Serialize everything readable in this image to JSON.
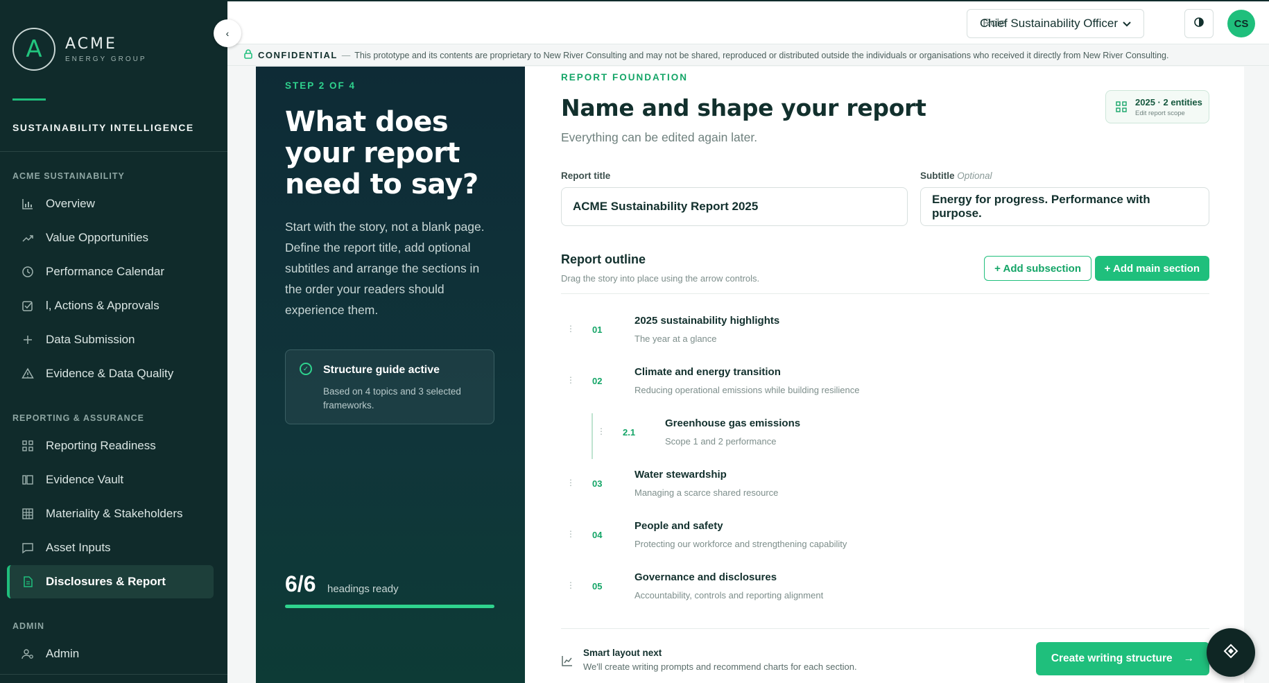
{
  "brand": {
    "logo_letter": "A",
    "name": "ACME",
    "sub": "ENERGY GROUP",
    "product": "SUSTAINABILITY INTELLIGENCE"
  },
  "sidebar": {
    "groups": [
      {
        "label": "ACME SUSTAINABILITY"
      },
      {
        "label": "REPORTING & ASSURANCE"
      },
      {
        "label": "ADMIN"
      }
    ],
    "items": [
      {
        "label": "Overview",
        "icon": "bar-chart-icon"
      },
      {
        "label": "Value Opportunities",
        "icon": "trend-icon"
      },
      {
        "label": "Performance Calendar",
        "icon": "clock-icon"
      },
      {
        "label": "Actions & Approvals",
        "prefix": "l,",
        "icon": "checkbox-icon"
      },
      {
        "label": "Data Submission",
        "icon": "plus-icon"
      },
      {
        "label": "Evidence & Data Quality",
        "icon": "warning-icon"
      },
      {
        "label": "Reporting Readiness",
        "icon": "grid-icon"
      },
      {
        "label": "Evidence Vault",
        "icon": "columns-icon"
      },
      {
        "label": "Materiality & Stakeholders",
        "icon": "table-icon"
      },
      {
        "label": "Asset Inputs",
        "icon": "chat-icon"
      },
      {
        "label": "Disclosures & Report",
        "icon": "document-icon"
      },
      {
        "label": "Admin",
        "icon": "users-gear-icon"
      }
    ]
  },
  "topbar": {
    "role_label": "Role",
    "role_value": "Chief Sustainability Officer",
    "avatar": "CS"
  },
  "confidential": {
    "tag": "CONFIDENTIAL",
    "dash": "—",
    "text": "This prototype and its contents are proprietary to New River Consulting and may not be shared, reproduced or distributed outside the individuals or organisations who received it directly from New River Consulting."
  },
  "step": {
    "label": "STEP 2 OF 4",
    "title": "What does your report need to say?",
    "desc": "Start with the story, not a blank page. Define the report title, add optional subtitles and arrange the sections in the order your readers should experience them.",
    "guide_title": "Structure guide active",
    "guide_sub": "Based on 4 topics and 3 selected frameworks.",
    "ready_big": "6/6",
    "ready_text": "headings ready",
    "ready_fraction": 1.0
  },
  "main": {
    "eyebrow": "REPORT FOUNDATION",
    "title": "Name and shape your report",
    "subtitle": "Everything can be edited again later.",
    "scope_main": "2025 · 2 entities",
    "scope_sub": "Edit report scope",
    "report_title_label": "Report title",
    "report_title_value": "ACME Sustainability Report 2025",
    "subtitle_label": "Subtitle",
    "subtitle_optional": "Optional",
    "subtitle_value": "Energy for progress. Performance with purpose.",
    "outline_title": "Report outline",
    "outline_sub": "Drag the story into place using the arrow controls.",
    "add_subsection": "+ Add subsection",
    "add_main_section": "+ Add main section",
    "sections": [
      {
        "num": "01",
        "name": "2025 sustainability highlights",
        "desc": "The year at a glance"
      },
      {
        "num": "02",
        "name": "Climate and energy transition",
        "desc": "Reducing operational emissions while building resilience"
      },
      {
        "num": "2.1",
        "name": "Greenhouse gas emissions",
        "desc": "Scope 1 and 2 performance"
      },
      {
        "num": "03",
        "name": "Water stewardship",
        "desc": "Managing a scarce shared resource"
      },
      {
        "num": "04",
        "name": "People and safety",
        "desc": "Protecting our workforce and strengthening capability"
      },
      {
        "num": "05",
        "name": "Governance and disclosures",
        "desc": "Accountability, controls and reporting alignment"
      }
    ],
    "smart_title": "Smart layout next",
    "smart_sub": "We'll create writing prompts and recommend charts for each section.",
    "create_button": "Create writing structure",
    "create_arrow": "→"
  }
}
